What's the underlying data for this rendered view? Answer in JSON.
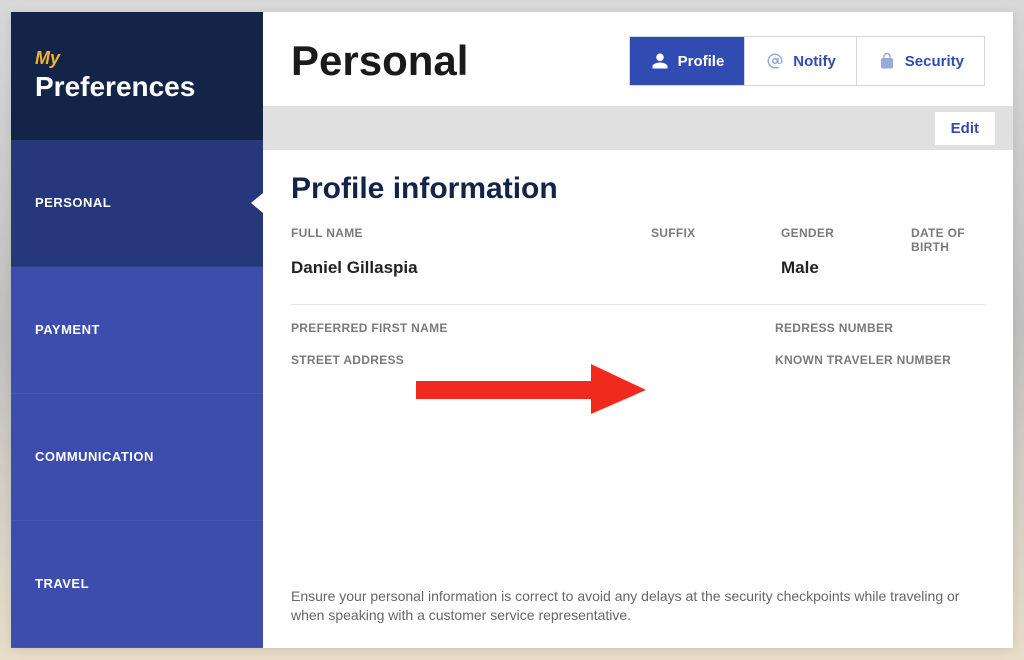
{
  "sidebar": {
    "brand_prefix": "My",
    "brand_main": "Preferences",
    "items": [
      {
        "label": "PERSONAL",
        "active": true
      },
      {
        "label": "PAYMENT",
        "active": false
      },
      {
        "label": "COMMUNICATION",
        "active": false
      },
      {
        "label": "TRAVEL",
        "active": false
      }
    ]
  },
  "header": {
    "title": "Personal",
    "tabs": [
      {
        "label": "Profile",
        "active": true,
        "icon": "person-icon"
      },
      {
        "label": "Notify",
        "active": false,
        "icon": "at-sign-icon"
      },
      {
        "label": "Security",
        "active": false,
        "icon": "lock-icon"
      }
    ],
    "edit_label": "Edit"
  },
  "profile": {
    "section_title": "Profile information",
    "labels": {
      "full_name": "FULL NAME",
      "suffix": "SUFFIX",
      "gender": "GENDER",
      "dob": "DATE OF BIRTH",
      "preferred_first_name": "PREFERRED FIRST NAME",
      "street_address": "STREET ADDRESS",
      "redress_number": "REDRESS NUMBER",
      "known_traveler": "KNOWN TRAVELER NUMBER"
    },
    "values": {
      "full_name": "Daniel Gillaspia",
      "suffix": "",
      "gender": "Male",
      "dob": ""
    },
    "footer": "Ensure your personal information is correct to avoid any delays at the security checkpoints while traveling or when speaking with a customer service representative."
  },
  "annotation": {
    "arrow_color": "#f02a1d"
  }
}
